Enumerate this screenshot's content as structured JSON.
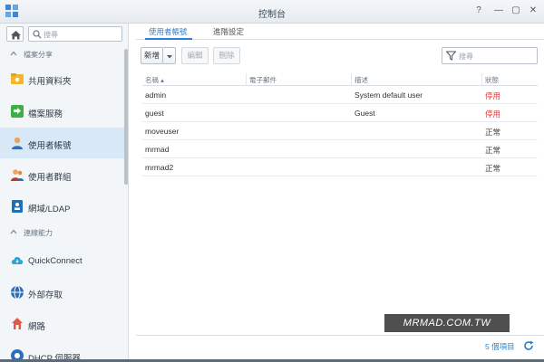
{
  "window": {
    "title": "控制台",
    "controls": [
      "?",
      "—",
      "▢",
      "✕"
    ]
  },
  "sidebar": {
    "search_placeholder": "搜尋",
    "sections": [
      {
        "label": "檔案分享",
        "items": [
          {
            "label": "共用資料夾",
            "icon": "shared-folder-icon"
          },
          {
            "label": "檔案服務",
            "icon": "file-services-icon"
          },
          {
            "label": "使用者帳號",
            "icon": "user-icon",
            "active": true
          },
          {
            "label": "使用者群組",
            "icon": "group-icon"
          },
          {
            "label": "網域/LDAP",
            "icon": "domain-ldap-icon"
          }
        ]
      },
      {
        "label": "連線能力",
        "items": [
          {
            "label": "QuickConnect",
            "icon": "quickconnect-icon"
          },
          {
            "label": "外部存取",
            "icon": "external-access-icon"
          },
          {
            "label": "網路",
            "icon": "network-icon"
          },
          {
            "label": "DHCP 伺服器",
            "icon": "dhcp-server-icon"
          }
        ]
      }
    ]
  },
  "tabs": [
    {
      "label": "使用者帳號",
      "active": true
    },
    {
      "label": "進階設定",
      "active": false
    }
  ],
  "toolbar": {
    "create_label": "新增",
    "edit_label": "編輯",
    "delete_label": "刪除",
    "filter_placeholder": "搜尋"
  },
  "table": {
    "columns": [
      "名稱 ▴",
      "電子郵件",
      "描述",
      "狀態"
    ],
    "rows": [
      {
        "name": "admin",
        "email": "",
        "description": "System default user",
        "status": "停用",
        "status_color": "#d63b3b"
      },
      {
        "name": "guest",
        "email": "",
        "description": "Guest",
        "status": "停用",
        "status_color": "#d63b3b"
      },
      {
        "name": "moveuser",
        "email": "",
        "description": "",
        "status": "正常",
        "status_color": "#444444"
      },
      {
        "name": "mrmad",
        "email": "",
        "description": "",
        "status": "正常",
        "status_color": "#444444"
      },
      {
        "name": "mrmad2",
        "email": "",
        "description": "",
        "status": "正常",
        "status_color": "#444444"
      }
    ]
  },
  "footer": {
    "count_label": "5 個項目"
  },
  "watermark": "MRMAD.COM.TW",
  "colors": {
    "accent": "#2a7fd4",
    "disabled_status": "#d63b3b",
    "active_nav": "#d8e8f7"
  }
}
